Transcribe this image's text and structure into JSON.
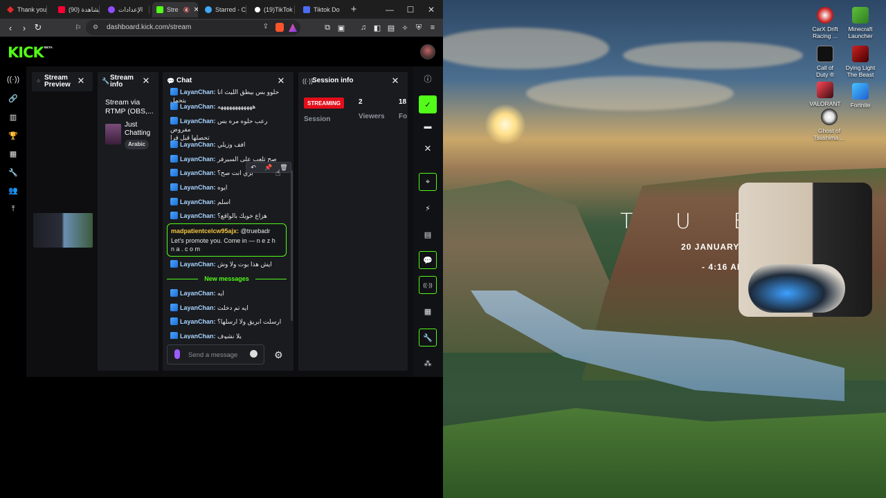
{
  "browser": {
    "tabs": [
      {
        "label": "Thank you",
        "color": "#e32929"
      },
      {
        "label": "(90) مشاهدة",
        "color": "#ff0033"
      },
      {
        "label": "الإعدادات",
        "color": "#8f4dff"
      },
      {
        "label": "Stre",
        "color": "#53fc18"
      },
      {
        "label": "Starred - C",
        "color": "#3fa9f5"
      },
      {
        "label": "(19)TikTok",
        "color": "#ffffff"
      },
      {
        "label": "Tiktok Do",
        "color": "#4a6cf7"
      }
    ],
    "new_tab": "+",
    "url": "dashboard.kick.com/stream",
    "window_controls": {
      "minimize": "—",
      "maximize": "☐",
      "close": "✕"
    }
  },
  "kick": {
    "logo": "KICK",
    "logo_badge": "BETA",
    "stream_preview": {
      "title_line1": "Stream",
      "title_line2": "Preview"
    },
    "stream_info": {
      "title_line1": "Stream",
      "title_line2": "info",
      "stream_title_line1": "Stream via",
      "stream_title_line2": "RTMP (OBS,...",
      "category_line1": "Just",
      "category_line2": "Chatting",
      "tag": "Arabic"
    },
    "chat": {
      "title": "Chat",
      "messages": [
        {
          "user": "LayanChan:",
          "text": "حلوو بس بيطق الليث انا بتحمل"
        },
        {
          "user": "LayanChan:",
          "text": "ههههههههههههه"
        },
        {
          "user": "LayanChan:",
          "text": "رعب حلوه مره بس مفروض",
          "text2": "تحصلها قبل قرا"
        },
        {
          "user": "LayanChan:",
          "text": "افف وزيلي"
        },
        {
          "user": "LayanChan:",
          "text": "صح تلعب على السيرفر"
        },
        {
          "user": "LayanChan:",
          "text": "بري انت صح؟"
        },
        {
          "user": "LayanChan:",
          "text": "ايوه"
        },
        {
          "user": "LayanChan:",
          "text": "اسلم"
        },
        {
          "user": "LayanChan:",
          "text": "هزاع خويك بالواقع؟"
        }
      ],
      "highlight": {
        "user": "madpatientcelcw95ajx:",
        "mention": "@truebadr",
        "line1": "Let's promote you. Come in — n e z h",
        "line2": "n a . c o m"
      },
      "after_highlight": {
        "user": "LayanChan:",
        "text": "ايش هذا بوت ولا وش"
      },
      "new_messages_label": "New messages",
      "new_messages": [
        {
          "user": "LayanChan:",
          "text": "ايه"
        },
        {
          "user": "LayanChan:",
          "text": "ايه تم دخلت"
        },
        {
          "user": "LayanChan:",
          "text": "ارسلت ابريق ولا ارسلها؟"
        },
        {
          "user": "LayanChan:",
          "text": "يلا نشوف"
        }
      ],
      "input_placeholder": "Send a message"
    },
    "session_info": {
      "title": "Session info",
      "status": "STREAMING",
      "status_label": "Session",
      "viewers_value": "2",
      "viewers_label": "Viewers",
      "followers_value": "18",
      "followers_label": "Fo"
    }
  },
  "desktop": {
    "icons": [
      {
        "line1": "CarX Drift",
        "line2": "Racing ..."
      },
      {
        "line1": "Minecraft",
        "line2": "Launcher"
      },
      {
        "line1": "Call of",
        "line2": "Duty ®"
      },
      {
        "line1": "Dying Light",
        "line2": "The Beast"
      },
      {
        "line1": "VALORANT",
        "line2": ""
      },
      {
        "line1": "Fortnite",
        "line2": ""
      },
      {
        "line1": "Ghost of",
        "line2": "Tsushima ..."
      }
    ],
    "clock": {
      "letters": "T U E S",
      "date": "20  JANUARY,",
      "time": "- 4:16 AM"
    }
  },
  "colors": {
    "kick_green": "#53fc18",
    "streaming_red": "#e30e1a",
    "chat_username": "#a9d4ff"
  }
}
